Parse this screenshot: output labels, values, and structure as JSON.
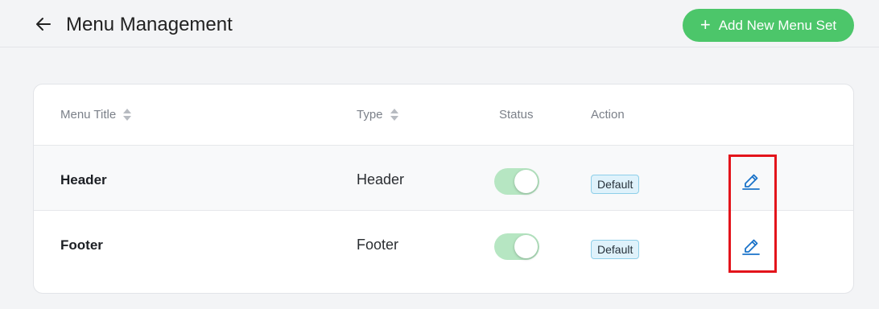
{
  "header": {
    "title": "Menu Management",
    "add_button_icon": "plus-icon",
    "add_button_label": "Add New Menu Set",
    "back_icon": "arrow-left-icon"
  },
  "table": {
    "columns": [
      {
        "label": "Menu Title",
        "sortable": true
      },
      {
        "label": "Type",
        "sortable": true
      },
      {
        "label": "Status",
        "sortable": false
      },
      {
        "label": "Action",
        "sortable": false
      }
    ],
    "rows": [
      {
        "title": "Header",
        "type": "Header",
        "status_on": true,
        "badge": "Default",
        "edit_icon": "edit-pencil-icon"
      },
      {
        "title": "Footer",
        "type": "Footer",
        "status_on": true,
        "badge": "Default",
        "edit_icon": "edit-pencil-icon"
      }
    ]
  },
  "colors": {
    "accent_green": "#4cc66a",
    "toggle_on": "#b6e6c2",
    "badge_bg": "#dff2fb",
    "badge_border": "#8ecfe9",
    "edit_icon": "#1a73c9",
    "highlight": "#e3141b"
  }
}
